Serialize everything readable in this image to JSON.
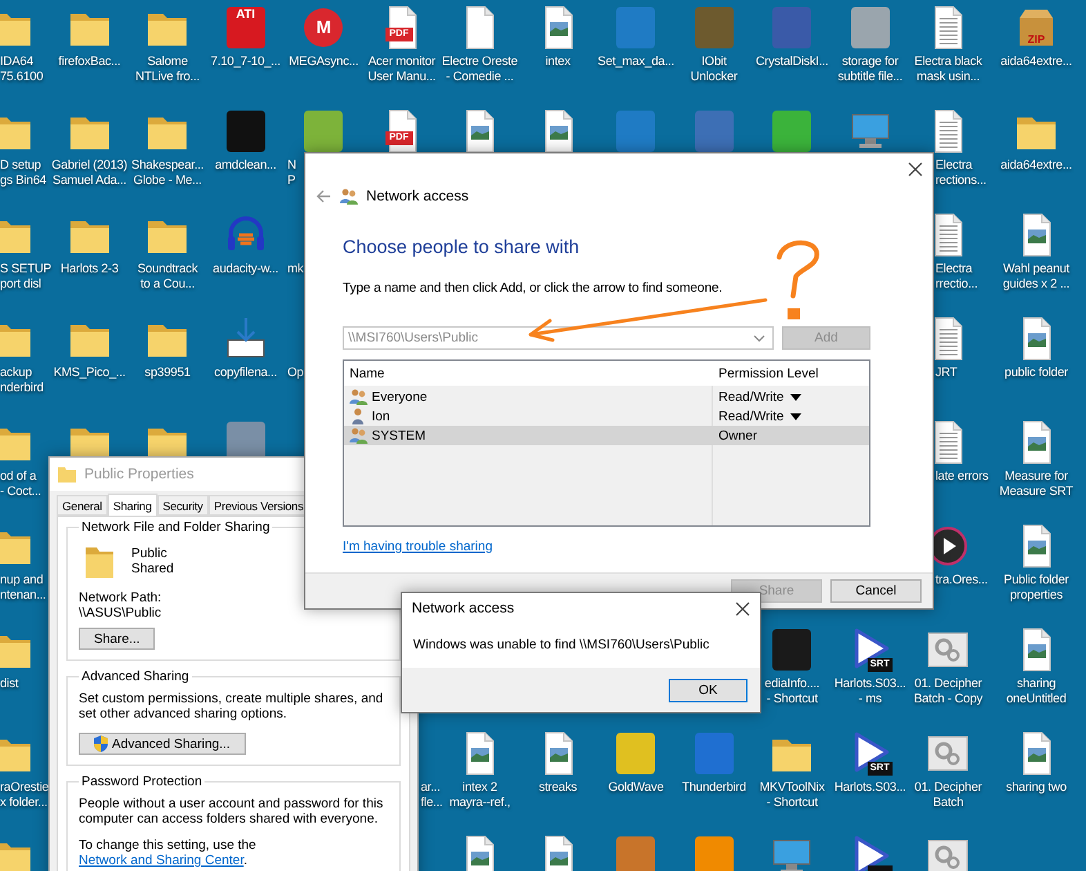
{
  "desktop": {
    "rows": [
      [
        {
          "kind": "folder",
          "label": "IDA64\n75.6100"
        },
        {
          "kind": "folder",
          "label": "firefoxBac..."
        },
        {
          "kind": "folder",
          "label": "Salome\nNTLive fro..."
        },
        {
          "kind": "app",
          "color": "#d71920",
          "badge": "ATI",
          "label": "7.10_7-10_..."
        },
        {
          "kind": "round",
          "color": "#d9272e",
          "badge": "M",
          "label": "MEGAsync..."
        },
        {
          "kind": "pdf",
          "badge": "PDF",
          "label": "Acer monitor\nUser Manu..."
        },
        {
          "kind": "blank",
          "label": "Electre Oreste\n- Comedie ..."
        },
        {
          "kind": "image",
          "label": "intex"
        },
        {
          "kind": "app",
          "color": "#1f7bc4",
          "label": "Set_max_da..."
        },
        {
          "kind": "app",
          "color": "#6d5a2e",
          "label": "IObit\nUnlocker"
        },
        {
          "kind": "app",
          "color": "#3a5aa8",
          "label": "CrystalDiskI..."
        },
        {
          "kind": "app",
          "color": "#9aa5ad",
          "label": "storage for\nsubtitle file..."
        },
        {
          "kind": "text",
          "label": "Electra black\nmask usin..."
        },
        {
          "kind": "zip",
          "badge": "ZIP",
          "label": "aida64extre..."
        }
      ],
      [
        {
          "kind": "folder",
          "label": "D setup\ngs Bin64"
        },
        {
          "kind": "folder",
          "label": "Gabriel (2013)\nSamuel Ada..."
        },
        {
          "kind": "folder",
          "label": "Shakespear...\nGlobe - Me..."
        },
        {
          "kind": "app",
          "color": "#111111",
          "label": "amdclean..."
        },
        {
          "kind": "app",
          "color": "#7db33a",
          "label": "N\nP"
        },
        {
          "kind": "pdf",
          "badge": "PDF"
        },
        {
          "kind": "image"
        },
        {
          "kind": "image"
        },
        {
          "kind": "app",
          "color": "#1f7bc4"
        },
        {
          "kind": "app",
          "color": "#3d6fb5"
        },
        {
          "kind": "app",
          "color": "#3bb33b"
        },
        {
          "kind": "computer"
        },
        {
          "kind": "text",
          "label": "Electra\nrections..."
        },
        {
          "kind": "folder",
          "label": "aida64extre..."
        }
      ],
      [
        {
          "kind": "folder",
          "label": "S SETUP\nport disl"
        },
        {
          "kind": "folder",
          "label": "Harlots 2-3"
        },
        {
          "kind": "folder",
          "label": "Soundtrack\nto a Cou..."
        },
        {
          "kind": "audio",
          "label": "audacity-w..."
        },
        {
          "label": "mk"
        },
        null,
        null,
        null,
        null,
        null,
        null,
        null,
        {
          "kind": "text",
          "label": "Electra\nrrectio..."
        },
        {
          "kind": "image",
          "label": "Wahl peanut\nguides x 2 ..."
        }
      ],
      [
        {
          "kind": "folder",
          "label": "ackup\nnderbird"
        },
        {
          "kind": "folder",
          "label": "KMS_Pico_..."
        },
        {
          "kind": "folder",
          "label": "sp39951"
        },
        {
          "kind": "download",
          "label": "copyfilena..."
        },
        {
          "label": "Op"
        },
        null,
        null,
        null,
        null,
        null,
        null,
        null,
        {
          "kind": "text",
          "label": "JRT"
        },
        {
          "kind": "image",
          "label": "public folder"
        }
      ],
      [
        {
          "kind": "folder",
          "label": "od of a\n- Coct..."
        },
        {
          "kind": "folder"
        },
        {
          "kind": "folder"
        },
        {
          "kind": "app",
          "color": "#7a8fa6"
        },
        null,
        null,
        null,
        null,
        null,
        null,
        null,
        null,
        {
          "kind": "text",
          "label": "late errors"
        },
        {
          "kind": "image",
          "label": "Measure for\nMeasure SRT"
        }
      ],
      [
        {
          "kind": "folder",
          "label": "nup and\nntenan..."
        },
        null,
        null,
        null,
        null,
        null,
        null,
        null,
        null,
        null,
        null,
        null,
        {
          "kind": "media",
          "label": "tra.Ores..."
        },
        {
          "kind": "image",
          "label": "Public folder\nproperties"
        }
      ],
      [
        {
          "kind": "folder",
          "label": "dist"
        },
        null,
        null,
        null,
        null,
        null,
        null,
        null,
        null,
        null,
        {
          "kind": "app",
          "color": "#1a1a1a",
          "label": "ediaInfo....\n- Shortcut"
        },
        {
          "kind": "play",
          "badge": "SRT",
          "label": "Harlots.S03...\n- ms"
        },
        {
          "kind": "batch",
          "label": "01. Decipher\nBatch - Copy"
        },
        {
          "kind": "image",
          "label": "sharing\noneUntitled"
        }
      ],
      [
        {
          "kind": "folder",
          "label": "raOrestie\nx folder..."
        },
        null,
        null,
        null,
        null,
        {
          "label": "ar...\nfle..."
        },
        {
          "kind": "image",
          "label": "intex 2\nmayra--ref.,"
        },
        {
          "kind": "image",
          "label": "streaks"
        },
        {
          "kind": "app",
          "color": "#e0c020",
          "label": "GoldWave"
        },
        {
          "kind": "app",
          "color": "#1f6fd1",
          "label": "Thunderbird"
        },
        {
          "kind": "folder",
          "label": "MKVToolNix\n- Shortcut"
        },
        {
          "kind": "play",
          "badge": "SRT",
          "label": "Harlots.S03..."
        },
        {
          "kind": "batch",
          "label": "01. Decipher\nBatch"
        },
        {
          "kind": "image",
          "label": "sharing two"
        }
      ],
      [
        {
          "kind": "folder"
        },
        null,
        null,
        null,
        null,
        null,
        {
          "kind": "image"
        },
        {
          "kind": "image"
        },
        {
          "kind": "app",
          "color": "#c8742a"
        },
        {
          "kind": "app",
          "color": "#f08a00"
        },
        {
          "kind": "computer"
        },
        {
          "kind": "play"
        },
        {
          "kind": "batch"
        },
        null
      ]
    ]
  },
  "properties_window": {
    "title": "Public Properties",
    "active": false,
    "tabs": [
      {
        "label": "General",
        "selected": false
      },
      {
        "label": "Sharing",
        "selected": true
      },
      {
        "label": "Security",
        "selected": false
      },
      {
        "label": "Previous Versions",
        "selected": false
      }
    ],
    "network_sharing": {
      "heading": "Network File and Folder Sharing",
      "folder_name": "Public",
      "folder_status": "Shared",
      "path_label": "Network Path:",
      "path": "\\\\ASUS\\Public",
      "button": "Share..."
    },
    "advanced_sharing": {
      "heading": "Advanced Sharing",
      "description": "Set custom permissions, create multiple shares, and set other advanced sharing options.",
      "button": "Advanced Sharing..."
    },
    "password_protection": {
      "heading": "Password Protection",
      "description": "People without a user account and password for this computer can access folders shared with everyone.",
      "note_before": "To change this setting, use the ",
      "note_link": "Network and Sharing Center",
      "note_after": "."
    }
  },
  "share_window": {
    "title": "Network access",
    "heading": "Choose people to share with",
    "instruction": "Type a name and then click Add, or click the arrow to find someone.",
    "name_field": {
      "value": "\\\\MSI760\\Users\\Public",
      "disabled": true
    },
    "add_button": {
      "label": "Add",
      "disabled": true
    },
    "table": {
      "columns": [
        "Name",
        "Permission Level"
      ],
      "rows": [
        {
          "name": "Everyone",
          "kind": "group",
          "permission": "Read/Write",
          "menu": true,
          "selected": false
        },
        {
          "name": "Ion",
          "kind": "user",
          "permission": "Read/Write",
          "menu": true,
          "selected": false
        },
        {
          "name": "SYSTEM",
          "kind": "group",
          "permission": "Owner",
          "menu": false,
          "selected": true
        }
      ]
    },
    "help_link": "I'm having trouble sharing",
    "buttons": [
      {
        "label": "Share",
        "disabled": true
      },
      {
        "label": "Cancel",
        "disabled": false
      }
    ]
  },
  "error_dialog": {
    "title": "Network access",
    "message": "Windows was unable to find \\\\MSI760\\Users\\Public",
    "buttons": [
      {
        "label": "OK",
        "focused": true
      }
    ]
  }
}
